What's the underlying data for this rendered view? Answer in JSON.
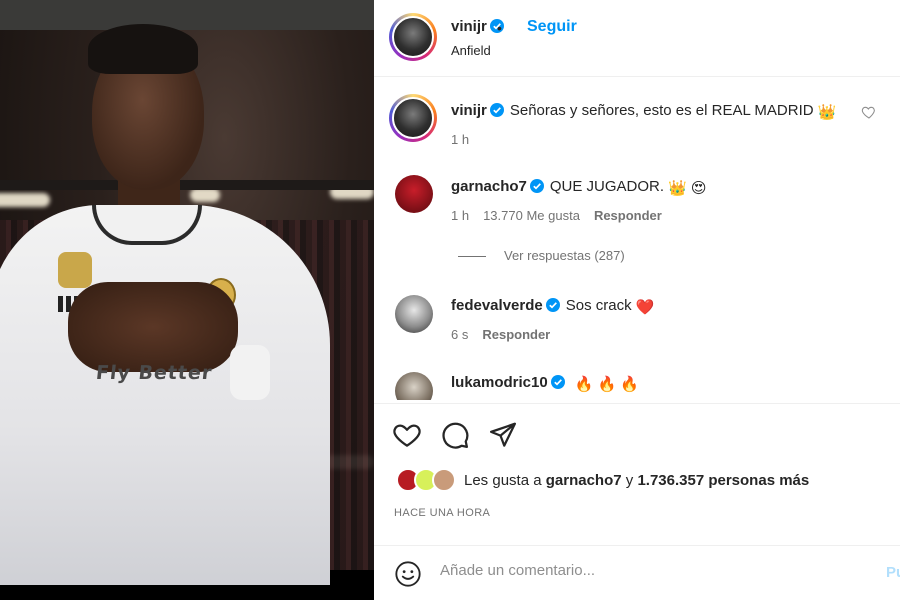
{
  "post": {
    "author": "vinijr",
    "follow_label": "Seguir",
    "separator": "•",
    "location": "Anfield",
    "caption": "Señoras y señores, esto es el REAL MADRID",
    "caption_emoji": "👑",
    "caption_time": "1 h",
    "image_sponsor_text": "Fly Better"
  },
  "comments": [
    {
      "username": "garnacho7",
      "verified": true,
      "text": "QUE JUGADOR.",
      "emoji": "👑 😍",
      "time": "1 h",
      "likes": "13.770 Me gusta",
      "reply": "Responder",
      "view_replies": "Ver respuestas (287)"
    },
    {
      "username": "fedevalverde",
      "verified": true,
      "text": "Sos crack",
      "emoji": "❤️",
      "time": "6 s",
      "reply": "Responder"
    },
    {
      "username": "lukamodric10",
      "verified": true,
      "text": "",
      "emoji": "🔥 🔥 🔥"
    }
  ],
  "actions": {
    "like_icon": "heart-icon",
    "comment_icon": "comment-icon",
    "share_icon": "share-icon"
  },
  "likes": {
    "prefix": "Les gusta a",
    "user": "garnacho7",
    "connector": "y",
    "others": "1.736.357 personas más"
  },
  "timestamp": "HACE UNA HORA",
  "comment_box": {
    "placeholder": "Añade un comentario...",
    "post_label": "Publicar"
  },
  "colors": {
    "link_blue": "#0095f6",
    "verified_blue": "#0095f6",
    "heart_red": "#ed4956",
    "muted_text": "#737373"
  }
}
